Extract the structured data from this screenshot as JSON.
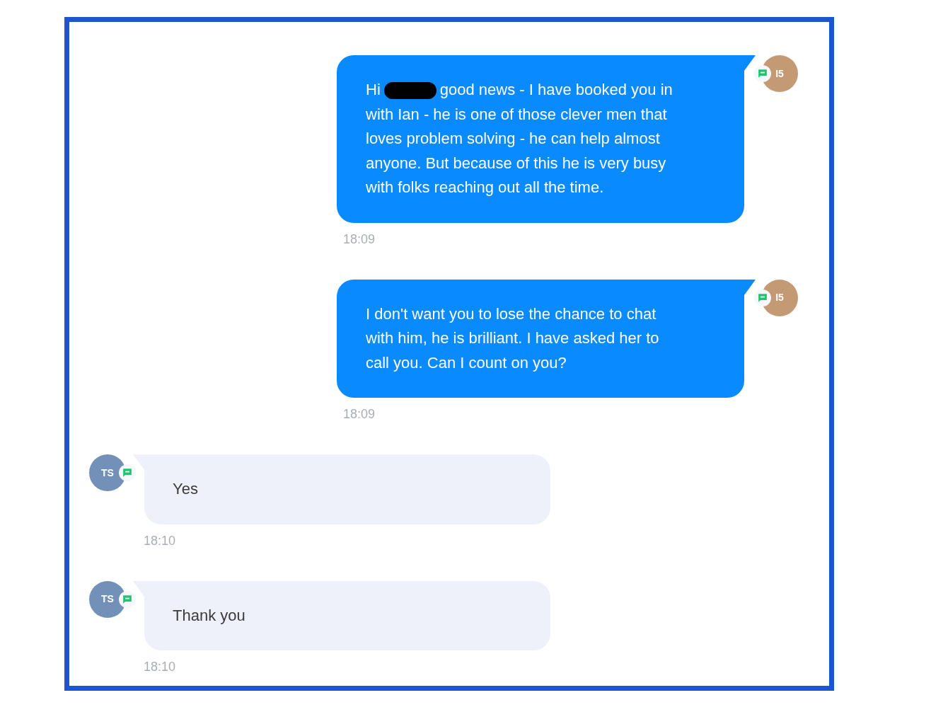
{
  "conversation": {
    "messages": [
      {
        "kind": "outgoing",
        "avatar": {
          "initials": "I5",
          "color": "#c49a74"
        },
        "parts": [
          {
            "kind": "text",
            "text": "Hi"
          },
          {
            "kind": "redaction"
          },
          {
            "kind": "text",
            "text": "good news - I have booked you in"
          },
          {
            "kind": "text",
            "text": "with Ian - he is one of those clever men that loves problem solving - he can help almost anyone. But because of this he is very busy with folks reaching out all the time."
          }
        ],
        "time": "18:09"
      },
      {
        "kind": "outgoing",
        "avatar": {
          "initials": "I5",
          "color": "#c49a74"
        },
        "parts": [
          {
            "kind": "text",
            "text": "I don't want you to lose the chance to chat with him, he is brilliant. I have asked her to call you. Can I count on you?"
          }
        ],
        "time": "18:09"
      },
      {
        "kind": "incoming",
        "avatar": {
          "initials": "TS",
          "color": "#7391b8"
        },
        "parts": [
          {
            "kind": "text",
            "text": "Yes"
          }
        ],
        "time": "18:10"
      },
      {
        "kind": "incoming",
        "avatar": {
          "initials": "TS",
          "color": "#7391b8"
        },
        "parts": [
          {
            "kind": "text",
            "text": "Thank you"
          }
        ],
        "time": "18:10"
      }
    ]
  }
}
